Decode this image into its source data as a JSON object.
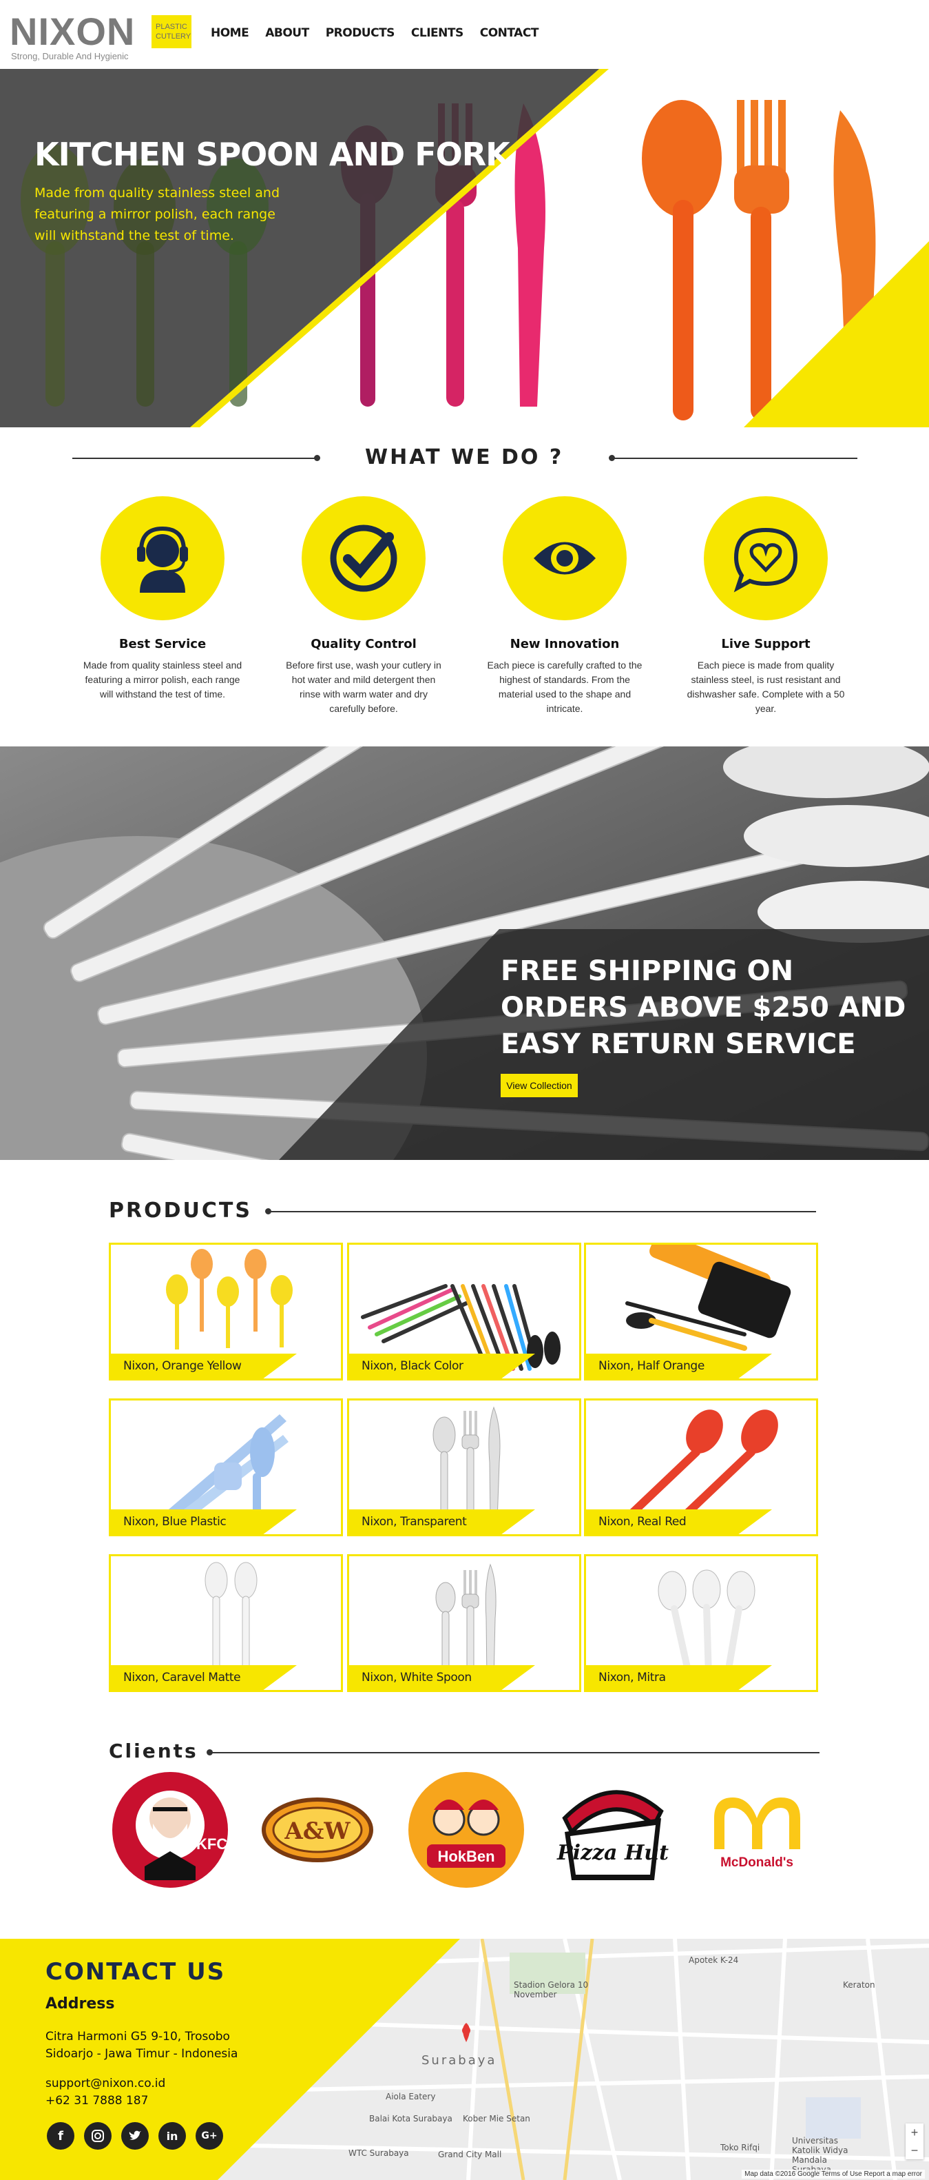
{
  "brand": {
    "name": "NIXON",
    "badge": "PLASTIC CUTLERY",
    "tagline": "Strong, Durable And Hygienic",
    "yellow": "#f7e600",
    "dark": "#1a2a4a"
  },
  "nav": [
    "HOME",
    "ABOUT",
    "PRODUCTS",
    "CLIENTS",
    "CONTACT"
  ],
  "hero": {
    "title": "KITCHEN SPOON AND FORK",
    "subtitle": "Made from quality stainless steel and featuring a mirror polish, each range will withstand the test of time."
  },
  "services": {
    "heading": "WHAT WE DO ?",
    "items": [
      {
        "icon": "headset-icon",
        "title": "Best Service",
        "text": "Made from quality stainless steel and featuring a mirror polish, each range will withstand the test of time."
      },
      {
        "icon": "check-circle-icon",
        "title": "Quality Control",
        "text": "Before first use, wash your cutlery in hot water and mild detergent then rinse with warm water and dry carefully before."
      },
      {
        "icon": "eye-icon",
        "title": "New Innovation",
        "text": "Each piece is carefully crafted to the highest of standards. From the material used to the shape and intricate."
      },
      {
        "icon": "heart-chat-icon",
        "title": "Live Support",
        "text": "Each piece is made from quality stainless steel, is rust resistant and dishwasher safe. Complete with a 50 year."
      }
    ]
  },
  "promo": {
    "title": "FREE SHIPPING ON ORDERS ABOVE $250 AND EASY RETURN SERVICE",
    "button": "View Collection"
  },
  "products": {
    "heading": "PRODUCTS",
    "items": [
      {
        "name": "Nixon, Orange Yellow"
      },
      {
        "name": "Nixon, Black Color"
      },
      {
        "name": "Nixon, Half Orange"
      },
      {
        "name": "Nixon, Blue Plastic"
      },
      {
        "name": "Nixon, Transparent"
      },
      {
        "name": "Nixon, Real Red"
      },
      {
        "name": "Nixon, Caravel Matte"
      },
      {
        "name": "Nixon, White Spoon"
      },
      {
        "name": "Nixon, Mitra"
      }
    ]
  },
  "clients": {
    "heading": "Clients",
    "logos": [
      "KFC",
      "A&W",
      "HokBen",
      "Pizza Hut",
      "McDonald's"
    ]
  },
  "contact": {
    "title": "CONTACT US",
    "address_heading": "Address",
    "address_line1": "Citra Harmoni G5 9-10, Trosobo",
    "address_line2": "Sidoarjo - Jawa Timur - Indonesia",
    "email": "support@nixon.co.id",
    "phone": "+62 31 7888 187",
    "socials": [
      "facebook-icon",
      "instagram-icon",
      "twitter-icon",
      "linkedin-icon",
      "google-plus-icon"
    ]
  },
  "map": {
    "labels": [
      "Apotek K-24",
      "Stadion Gelora 10 November",
      "Keraton",
      "Surabaya",
      "Aiola Eatery",
      "Balai Kota Surabaya",
      "Kober Mie Setan",
      "WTC Surabaya",
      "Grand City Mall",
      "Toko Rifqi",
      "Universitas Katolik Widya Mandala Surabaya"
    ],
    "footer": "Map data ©2016 Google   Terms of Use   Report a map error"
  }
}
